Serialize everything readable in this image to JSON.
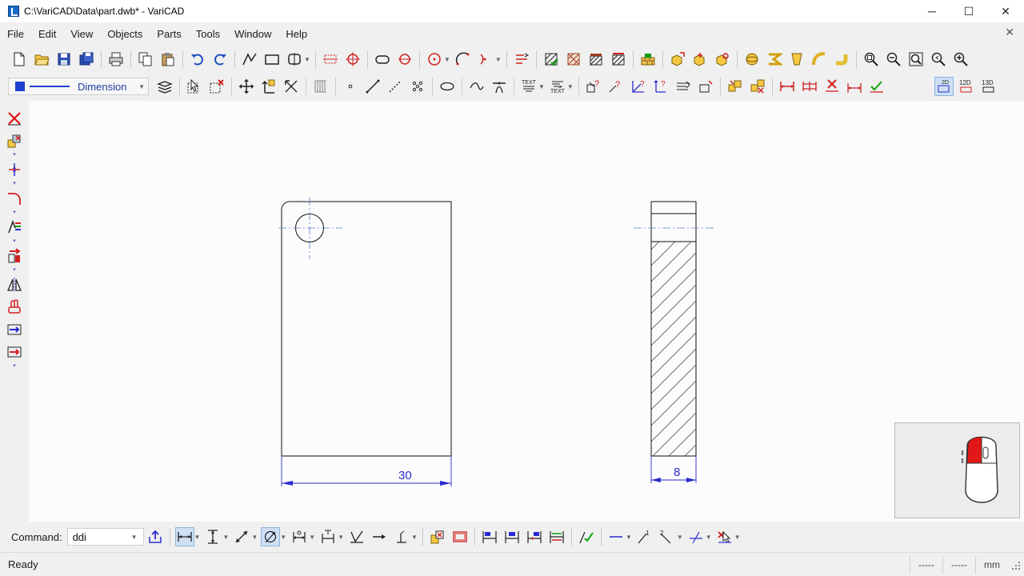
{
  "window": {
    "title": "C:\\VariCAD\\Data\\part.dwb* - VariCAD",
    "minimize_glyph": "─",
    "maximize_glyph": "☐",
    "close_glyph": "✕"
  },
  "menu": {
    "items": [
      "File",
      "Edit",
      "View",
      "Objects",
      "Parts",
      "Tools",
      "Window",
      "Help"
    ],
    "mdi_close_glyph": "✕"
  },
  "toolbar2": {
    "line_style": "Dimension"
  },
  "drawing": {
    "dim_front": "30",
    "dim_side": "8"
  },
  "command": {
    "label": "Command:",
    "value": "ddi"
  },
  "status": {
    "text": "Ready",
    "cell1": "-----",
    "cell2": "-----",
    "units": "mm"
  },
  "colors": {
    "accent_blue": "#1f3fd0",
    "delete_red": "#e01010",
    "drawing_line": "#111111",
    "dimension": "#2a2ad0"
  },
  "icons": {
    "toolbar1": [
      "new-file-icon",
      "open-file-icon",
      "save-icon",
      "save-all-icon",
      "print-icon",
      "copy-icon",
      "paste-icon",
      "undo-icon",
      "redo-icon",
      "polyline-icon",
      "rectangle-icon",
      "symmetric-icon",
      "grid-icon",
      "snap-icon",
      "slot-icon",
      "center-icon",
      "circle-icon",
      "arc-icon",
      "arc3-icon",
      "settings-icon",
      "hatch-icon",
      "hatch-pattern-icon",
      "hatch-edit-icon",
      "hatch-delete-icon",
      "wall-icon",
      "block-insert-icon",
      "block-icon",
      "block-edit-icon",
      "solid-sphere-icon",
      "solid-sweep-icon",
      "solid-loft-icon",
      "solid-bend-icon",
      "solid-pipe-icon",
      "zoom-window-icon",
      "zoom-out-icon",
      "zoom-fit-icon",
      "zoom-previous-icon",
      "zoom-in-icon"
    ],
    "toolbar2": [
      "layers-icon",
      "select-icon",
      "delete-select-icon",
      "move-icon",
      "transform-icon",
      "scale-icon",
      "hatch-grid-icon",
      "point-icon",
      "line-icon",
      "dashed-line-icon",
      "points-icon",
      "ellipse-icon",
      "curve-icon",
      "trim-icon",
      "text-icon",
      "text-edit-icon",
      "query-icon",
      "query-point-icon",
      "query-angle-icon",
      "query-length-icon",
      "query-area-icon",
      "frame-icon",
      "group-icon",
      "ungroup-icon",
      "dimension-icon",
      "dimension-chain-icon",
      "dimension-delete-icon",
      "dimension-edit-icon",
      "checkmark-icon",
      "view-2d-icon",
      "view-12d-icon",
      "view-13d-icon"
    ],
    "left": [
      "delete-icon",
      "copy-objects-icon",
      "trim-extend-icon",
      "fillet-icon",
      "properties-icon",
      "move-arrow-icon",
      "mirror-icon",
      "stretch-icon",
      "move-right-icon",
      "explode-icon"
    ],
    "bottom": [
      "command-export-icon",
      "dim-horizontal-icon",
      "dim-vertical-icon",
      "dim-aligned-icon",
      "dim-radius-icon",
      "dim-baseline-icon",
      "dim-chain-icon",
      "tolerance-icon",
      "arrow-icon",
      "leader-icon",
      "symbols-icon",
      "frame-insert-icon",
      "dim-left-icon",
      "dim-center-icon",
      "dim-split-icon",
      "dim-edit-icon",
      "confirm-icon",
      "line-type-icon",
      "slope-1-icon",
      "slope-2-icon",
      "crossing-icon",
      "delete-dim-icon"
    ]
  }
}
